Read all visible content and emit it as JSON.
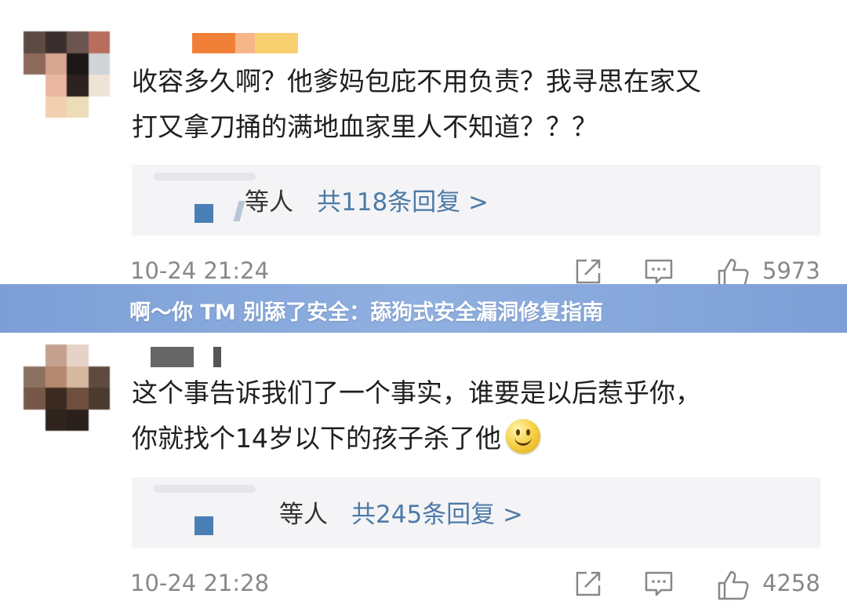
{
  "banner": {
    "title": "啊～你 TM 别舔了安全：舔狗式安全漏洞修复指南"
  },
  "comments": [
    {
      "text_line1": "收容多久啊？他爹妈包庇不用负责？我寻思在家又",
      "text_line2": "打又拿刀捅的满地血家里人不知道？？？",
      "reply_who": "等人",
      "reply_count": "共118条回复 >",
      "time": "10-24 21:24",
      "likes": "5973"
    },
    {
      "text_line1": "这个事告诉我们了一个事实，谁要是以后惹乎你，",
      "text_line2": "你就找个14岁以下的孩子杀了他",
      "reply_who": "等人",
      "reply_count": "共245条回复 >",
      "time": "10-24 21:28",
      "likes": "4258"
    }
  ],
  "icons": {
    "share": "share-icon",
    "comment": "comment-icon",
    "like": "thumbs-up-icon",
    "smiley": "smiley-emoji-icon"
  },
  "colors": {
    "banner": "#8aa9dc",
    "link": "#4d7aa8",
    "meta": "#888888",
    "reply_bg": "#f4f4f6"
  }
}
